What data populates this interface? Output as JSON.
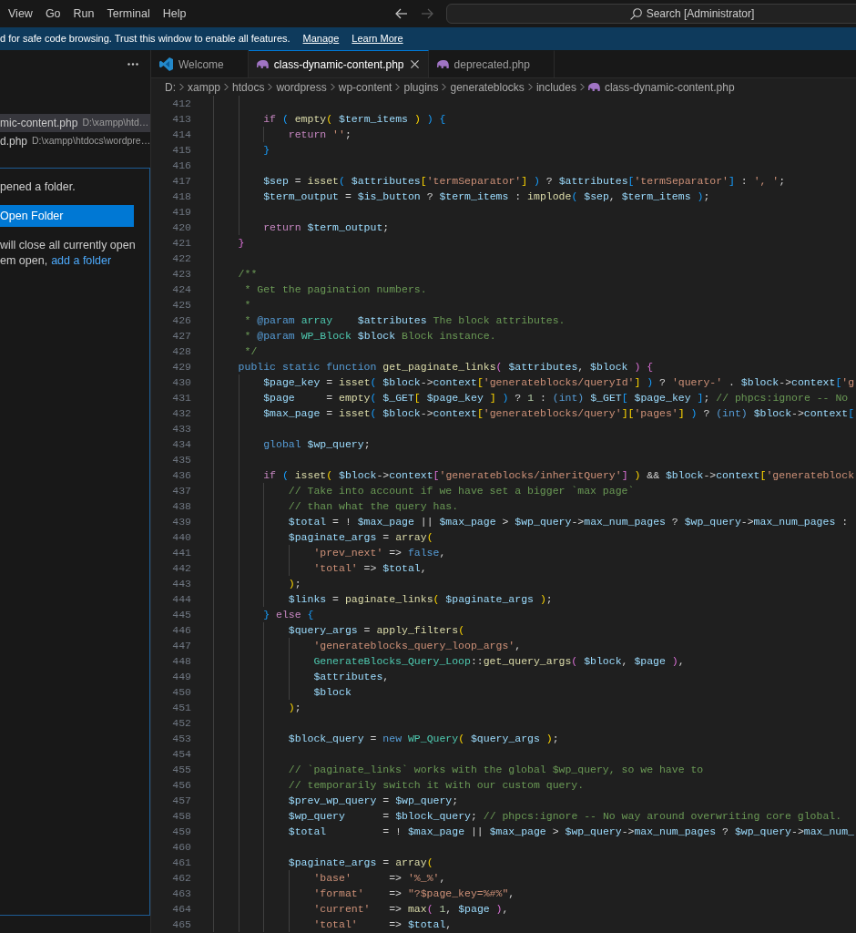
{
  "title_bar": {
    "menu": [
      "View",
      "Go",
      "Run",
      "Terminal",
      "Help"
    ],
    "nav": [
      {
        "kind": "back",
        "disabled": false
      },
      {
        "kind": "forward",
        "disabled": true
      }
    ],
    "search": {
      "label": "Search [Administrator]"
    }
  },
  "banner": {
    "message": "d for safe code browsing. Trust this window to enable all features.",
    "links": [
      "Manage",
      "Learn More"
    ]
  },
  "sidebar": {
    "open_editors": [
      {
        "name": "mic-content.php",
        "path": "D:\\xampp\\htd…",
        "selected": true
      },
      {
        "name": "d.php",
        "path": "D:\\xampp\\htdocs\\wordpre…",
        "selected": false
      }
    ],
    "no_folder": {
      "message": "pened a folder.",
      "button": "Open Folder",
      "note": "will close all currently open",
      "note_end": "em open,",
      "link": "add a folder"
    }
  },
  "tabs": [
    {
      "label": "Welcome",
      "kind": "welcome",
      "selected": false
    },
    {
      "label": "class-dynamic-content.php",
      "kind": "php",
      "selected": true
    },
    {
      "label": "deprecated.php",
      "kind": "php",
      "selected": false
    }
  ],
  "breadcrumb": [
    {
      "label": "D:",
      "kind": "folder"
    },
    {
      "label": "xampp",
      "kind": "folder"
    },
    {
      "label": "htdocs",
      "kind": "folder"
    },
    {
      "label": "wordpress",
      "kind": "folder"
    },
    {
      "label": "wp-content",
      "kind": "folder"
    },
    {
      "label": "plugins",
      "kind": "folder"
    },
    {
      "label": "generateblocks",
      "kind": "folder"
    },
    {
      "label": "includes",
      "kind": "folder"
    },
    {
      "label": "class-dynamic-content.php",
      "kind": "php"
    }
  ],
  "editor": {
    "lines": [
      {
        "number": "412"
      },
      {
        "number": "413",
        "code": [
          {
            "kind": "ctl",
            "text": "        if"
          },
          {
            "kind": "pun",
            "text": " ( "
          },
          {
            "kind": "fn",
            "text": "empty"
          },
          {
            "kind": "pun",
            "text": "( "
          },
          {
            "kind": "var",
            "text": "$term_items"
          },
          {
            "kind": "pun",
            "text": " ) ) {"
          }
        ]
      },
      {
        "number": "414",
        "code": [
          {
            "kind": "ctl",
            "text": "            return "
          },
          {
            "kind": "str",
            "text": "''"
          },
          {
            "kind": "pun",
            "text": ";"
          }
        ]
      },
      {
        "number": "415",
        "code": [
          {
            "kind": "pun",
            "text": "        }"
          }
        ]
      },
      {
        "number": "416"
      },
      {
        "number": "417",
        "code": [
          {
            "kind": "var",
            "text": "        $sep"
          },
          {
            "kind": "pun",
            "text": " = "
          },
          {
            "kind": "fn",
            "text": "isset"
          },
          {
            "kind": "pun",
            "text": "( "
          },
          {
            "kind": "var",
            "text": "$attributes"
          },
          {
            "kind": "pun",
            "text": "["
          },
          {
            "kind": "str",
            "text": "'termSeparator'"
          },
          {
            "kind": "pun",
            "text": "] ) ? "
          },
          {
            "kind": "var",
            "text": "$attributes"
          },
          {
            "kind": "pun",
            "text": "["
          },
          {
            "kind": "str",
            "text": "'termSeparator'"
          },
          {
            "kind": "pun",
            "text": "] : "
          },
          {
            "kind": "str",
            "text": "', '"
          },
          {
            "kind": "pun",
            "text": ";"
          }
        ]
      },
      {
        "number": "418",
        "code": [
          {
            "kind": "var",
            "text": "        $term_output"
          },
          {
            "kind": "pun",
            "text": " = "
          },
          {
            "kind": "var",
            "text": "$is_button"
          },
          {
            "kind": "pun",
            "text": " ? "
          },
          {
            "kind": "var",
            "text": "$term_items"
          },
          {
            "kind": "pun",
            "text": " : "
          },
          {
            "kind": "fn",
            "text": "implode"
          },
          {
            "kind": "pun",
            "text": "( "
          },
          {
            "kind": "var",
            "text": "$sep"
          },
          {
            "kind": "pun",
            "text": ", "
          },
          {
            "kind": "var",
            "text": "$term_items"
          },
          {
            "kind": "pun",
            "text": " );"
          }
        ]
      },
      {
        "number": "419"
      },
      {
        "number": "420",
        "code": [
          {
            "kind": "ctl",
            "text": "        return "
          },
          {
            "kind": "var",
            "text": "$term_output"
          },
          {
            "kind": "pun",
            "text": ";"
          }
        ]
      },
      {
        "number": "421",
        "code": [
          {
            "kind": "pun",
            "text": "    }"
          }
        ]
      },
      {
        "number": "422"
      },
      {
        "number": "423",
        "code": [
          {
            "kind": "com",
            "text": "    /**"
          }
        ]
      },
      {
        "number": "424",
        "code": [
          {
            "kind": "com",
            "text": "     * Get the pagination numbers."
          }
        ]
      },
      {
        "number": "425",
        "code": [
          {
            "kind": "com",
            "text": "     *"
          }
        ]
      },
      {
        "number": "426",
        "code": [
          {
            "kind": "com",
            "text": "     * "
          },
          {
            "kind": "tag",
            "text": "@param "
          },
          {
            "kind": "type",
            "text": "array    "
          },
          {
            "kind": "var",
            "text": "$attributes"
          },
          {
            "kind": "com",
            "text": " The block attributes."
          }
        ]
      },
      {
        "number": "427",
        "code": [
          {
            "kind": "com",
            "text": "     * "
          },
          {
            "kind": "tag",
            "text": "@param "
          },
          {
            "kind": "type",
            "text": "WP_Block "
          },
          {
            "kind": "var",
            "text": "$block"
          },
          {
            "kind": "com",
            "text": " Block instance."
          }
        ]
      },
      {
        "number": "428",
        "code": [
          {
            "kind": "com",
            "text": "     */"
          }
        ]
      },
      {
        "number": "429",
        "code": [
          {
            "kind": "key",
            "text": "    public static function "
          },
          {
            "kind": "fn",
            "text": "get_paginate_links"
          },
          {
            "kind": "pun",
            "text": "( "
          },
          {
            "kind": "var",
            "text": "$attributes"
          },
          {
            "kind": "pun",
            "text": ", "
          },
          {
            "kind": "var",
            "text": "$block"
          },
          {
            "kind": "pun",
            "text": " ) {"
          }
        ]
      },
      {
        "number": "430",
        "code": [
          {
            "kind": "var",
            "text": "        $page_key"
          },
          {
            "kind": "pun",
            "text": " = "
          },
          {
            "kind": "fn",
            "text": "isset"
          },
          {
            "kind": "pun",
            "text": "( "
          },
          {
            "kind": "var",
            "text": "$block"
          },
          {
            "kind": "pun",
            "text": "->"
          },
          {
            "kind": "var",
            "text": "context"
          },
          {
            "kind": "pun",
            "text": "["
          },
          {
            "kind": "str",
            "text": "'generateblocks/queryId'"
          },
          {
            "kind": "pun",
            "text": "] ) ? "
          },
          {
            "kind": "str",
            "text": "'query-'"
          },
          {
            "kind": "pun",
            "text": " . "
          },
          {
            "kind": "var",
            "text": "$block"
          },
          {
            "kind": "pun",
            "text": "->"
          },
          {
            "kind": "var",
            "text": "context"
          },
          {
            "kind": "pun",
            "text": "["
          },
          {
            "kind": "str",
            "text": "'g"
          }
        ]
      },
      {
        "number": "431",
        "code": [
          {
            "kind": "var",
            "text": "        $page"
          },
          {
            "kind": "pun",
            "text": "     = "
          },
          {
            "kind": "fn",
            "text": "empty"
          },
          {
            "kind": "pun",
            "text": "( "
          },
          {
            "kind": "var",
            "text": "$_GET"
          },
          {
            "kind": "pun",
            "text": "[ "
          },
          {
            "kind": "var",
            "text": "$page_key"
          },
          {
            "kind": "pun",
            "text": " ] ) ? "
          },
          {
            "kind": "num",
            "text": "1"
          },
          {
            "kind": "pun",
            "text": " : "
          },
          {
            "kind": "key",
            "text": "(int) "
          },
          {
            "kind": "var",
            "text": "$_GET"
          },
          {
            "kind": "pun",
            "text": "[ "
          },
          {
            "kind": "var",
            "text": "$page_key"
          },
          {
            "kind": "pun",
            "text": " ]; "
          },
          {
            "kind": "com",
            "text": "// phpcs:ignore -- No"
          }
        ]
      },
      {
        "number": "432",
        "code": [
          {
            "kind": "var",
            "text": "        $max_page"
          },
          {
            "kind": "pun",
            "text": " = "
          },
          {
            "kind": "fn",
            "text": "isset"
          },
          {
            "kind": "pun",
            "text": "( "
          },
          {
            "kind": "var",
            "text": "$block"
          },
          {
            "kind": "pun",
            "text": "->"
          },
          {
            "kind": "var",
            "text": "context"
          },
          {
            "kind": "pun",
            "text": "["
          },
          {
            "kind": "str",
            "text": "'generateblocks/query'"
          },
          {
            "kind": "pun",
            "text": "]["
          },
          {
            "kind": "str",
            "text": "'pages'"
          },
          {
            "kind": "pun",
            "text": "] ) ? "
          },
          {
            "kind": "key",
            "text": "(int) "
          },
          {
            "kind": "var",
            "text": "$block"
          },
          {
            "kind": "pun",
            "text": "->"
          },
          {
            "kind": "var",
            "text": "context"
          },
          {
            "kind": "pun",
            "text": "["
          }
        ]
      },
      {
        "number": "433"
      },
      {
        "number": "434",
        "code": [
          {
            "kind": "key",
            "text": "        global "
          },
          {
            "kind": "var",
            "text": "$wp_query"
          },
          {
            "kind": "pun",
            "text": ";"
          }
        ]
      },
      {
        "number": "435"
      },
      {
        "number": "436",
        "code": [
          {
            "kind": "ctl",
            "text": "        if"
          },
          {
            "kind": "pun",
            "text": " ( "
          },
          {
            "kind": "fn",
            "text": "isset"
          },
          {
            "kind": "pun",
            "text": "( "
          },
          {
            "kind": "var",
            "text": "$block"
          },
          {
            "kind": "pun",
            "text": "->"
          },
          {
            "kind": "var",
            "text": "context"
          },
          {
            "kind": "pun",
            "text": "["
          },
          {
            "kind": "str",
            "text": "'generateblocks/inheritQuery'"
          },
          {
            "kind": "pun",
            "text": "] ) && "
          },
          {
            "kind": "var",
            "text": "$block"
          },
          {
            "kind": "pun",
            "text": "->"
          },
          {
            "kind": "var",
            "text": "context"
          },
          {
            "kind": "pun",
            "text": "["
          },
          {
            "kind": "str",
            "text": "'generateblock"
          }
        ]
      },
      {
        "number": "437",
        "code": [
          {
            "kind": "com",
            "text": "            // Take into account if we have set a bigger `max page`"
          }
        ]
      },
      {
        "number": "438",
        "code": [
          {
            "kind": "com",
            "text": "            // than what the query has."
          }
        ]
      },
      {
        "number": "439",
        "code": [
          {
            "kind": "var",
            "text": "            $total"
          },
          {
            "kind": "pun",
            "text": " = ! "
          },
          {
            "kind": "var",
            "text": "$max_page"
          },
          {
            "kind": "pun",
            "text": " || "
          },
          {
            "kind": "var",
            "text": "$max_page"
          },
          {
            "kind": "pun",
            "text": " > "
          },
          {
            "kind": "var",
            "text": "$wp_query"
          },
          {
            "kind": "pun",
            "text": "->"
          },
          {
            "kind": "var",
            "text": "max_num_pages"
          },
          {
            "kind": "pun",
            "text": " ? "
          },
          {
            "kind": "var",
            "text": "$wp_query"
          },
          {
            "kind": "pun",
            "text": "->"
          },
          {
            "kind": "var",
            "text": "max_num_pages"
          },
          {
            "kind": "pun",
            "text": " :"
          }
        ]
      },
      {
        "number": "440",
        "code": [
          {
            "kind": "var",
            "text": "            $paginate_args"
          },
          {
            "kind": "pun",
            "text": " = "
          },
          {
            "kind": "fn",
            "text": "array"
          },
          {
            "kind": "pun",
            "text": "("
          }
        ]
      },
      {
        "number": "441",
        "code": [
          {
            "kind": "str",
            "text": "                'prev_next'"
          },
          {
            "kind": "pun",
            "text": " => "
          },
          {
            "kind": "key",
            "text": "false"
          },
          {
            "kind": "pun",
            "text": ","
          }
        ]
      },
      {
        "number": "442",
        "code": [
          {
            "kind": "str",
            "text": "                'total'"
          },
          {
            "kind": "pun",
            "text": " => "
          },
          {
            "kind": "var",
            "text": "$total"
          },
          {
            "kind": "pun",
            "text": ","
          }
        ]
      },
      {
        "number": "443",
        "code": [
          {
            "kind": "pun",
            "text": "            );"
          }
        ]
      },
      {
        "number": "444",
        "code": [
          {
            "kind": "var",
            "text": "            $links"
          },
          {
            "kind": "pun",
            "text": " = "
          },
          {
            "kind": "fn",
            "text": "paginate_links"
          },
          {
            "kind": "pun",
            "text": "( "
          },
          {
            "kind": "var",
            "text": "$paginate_args"
          },
          {
            "kind": "pun",
            "text": " );"
          }
        ]
      },
      {
        "number": "445",
        "code": [
          {
            "kind": "pun",
            "text": "        } "
          },
          {
            "kind": "ctl",
            "text": "else"
          },
          {
            "kind": "pun",
            "text": " {"
          }
        ]
      },
      {
        "number": "446",
        "code": [
          {
            "kind": "var",
            "text": "            $query_args"
          },
          {
            "kind": "pun",
            "text": " = "
          },
          {
            "kind": "fn",
            "text": "apply_filters"
          },
          {
            "kind": "pun",
            "text": "("
          }
        ]
      },
      {
        "number": "447",
        "code": [
          {
            "kind": "str",
            "text": "                'generateblocks_query_loop_args'"
          },
          {
            "kind": "pun",
            "text": ","
          }
        ]
      },
      {
        "number": "448",
        "code": [
          {
            "kind": "type",
            "text": "                GenerateBlocks_Query_Loop"
          },
          {
            "kind": "pun",
            "text": "::"
          },
          {
            "kind": "fn",
            "text": "get_query_args"
          },
          {
            "kind": "pun",
            "text": "( "
          },
          {
            "kind": "var",
            "text": "$block"
          },
          {
            "kind": "pun",
            "text": ", "
          },
          {
            "kind": "var",
            "text": "$page"
          },
          {
            "kind": "pun",
            "text": " ),"
          }
        ]
      },
      {
        "number": "449",
        "code": [
          {
            "kind": "var",
            "text": "                $attributes"
          },
          {
            "kind": "pun",
            "text": ","
          }
        ]
      },
      {
        "number": "450",
        "code": [
          {
            "kind": "var",
            "text": "                $block"
          }
        ]
      },
      {
        "number": "451",
        "code": [
          {
            "kind": "pun",
            "text": "            );"
          }
        ]
      },
      {
        "number": "452"
      },
      {
        "number": "453",
        "code": [
          {
            "kind": "var",
            "text": "            $block_query"
          },
          {
            "kind": "pun",
            "text": " = "
          },
          {
            "kind": "key",
            "text": "new "
          },
          {
            "kind": "type",
            "text": "WP_Query"
          },
          {
            "kind": "pun",
            "text": "( "
          },
          {
            "kind": "var",
            "text": "$query_args"
          },
          {
            "kind": "pun",
            "text": " );"
          }
        ]
      },
      {
        "number": "454"
      },
      {
        "number": "455",
        "code": [
          {
            "kind": "com",
            "text": "            // `paginate_links` works with the global $wp_query, so we have to"
          }
        ]
      },
      {
        "number": "456",
        "code": [
          {
            "kind": "com",
            "text": "            // temporarily switch it with our custom query."
          }
        ]
      },
      {
        "number": "457",
        "code": [
          {
            "kind": "var",
            "text": "            $prev_wp_query"
          },
          {
            "kind": "pun",
            "text": " = "
          },
          {
            "kind": "var",
            "text": "$wp_query"
          },
          {
            "kind": "pun",
            "text": ";"
          }
        ]
      },
      {
        "number": "458",
        "code": [
          {
            "kind": "var",
            "text": "            $wp_query"
          },
          {
            "kind": "pun",
            "text": "      = "
          },
          {
            "kind": "var",
            "text": "$block_query"
          },
          {
            "kind": "pun",
            "text": "; "
          },
          {
            "kind": "com",
            "text": "// phpcs:ignore -- No way around overwriting core global."
          }
        ]
      },
      {
        "number": "459",
        "code": [
          {
            "kind": "var",
            "text": "            $total"
          },
          {
            "kind": "pun",
            "text": "         = ! "
          },
          {
            "kind": "var",
            "text": "$max_page"
          },
          {
            "kind": "pun",
            "text": " || "
          },
          {
            "kind": "var",
            "text": "$max_page"
          },
          {
            "kind": "pun",
            "text": " > "
          },
          {
            "kind": "var",
            "text": "$wp_query"
          },
          {
            "kind": "pun",
            "text": "->"
          },
          {
            "kind": "var",
            "text": "max_num_pages"
          },
          {
            "kind": "pun",
            "text": " ? "
          },
          {
            "kind": "var",
            "text": "$wp_query"
          },
          {
            "kind": "pun",
            "text": "->"
          },
          {
            "kind": "var",
            "text": "max_num_"
          }
        ]
      },
      {
        "number": "460"
      },
      {
        "number": "461",
        "code": [
          {
            "kind": "var",
            "text": "            $paginate_args"
          },
          {
            "kind": "pun",
            "text": " = "
          },
          {
            "kind": "fn",
            "text": "array"
          },
          {
            "kind": "pun",
            "text": "("
          }
        ]
      },
      {
        "number": "462",
        "code": [
          {
            "kind": "str",
            "text": "                'base'"
          },
          {
            "kind": "pun",
            "text": "      => "
          },
          {
            "kind": "str",
            "text": "'%_%'"
          },
          {
            "kind": "pun",
            "text": ","
          }
        ]
      },
      {
        "number": "463",
        "code": [
          {
            "kind": "str",
            "text": "                'format'"
          },
          {
            "kind": "pun",
            "text": "    => "
          },
          {
            "kind": "str",
            "text": "\"?$page_key=%#%\""
          },
          {
            "kind": "pun",
            "text": ","
          }
        ]
      },
      {
        "number": "464",
        "code": [
          {
            "kind": "str",
            "text": "                'current'"
          },
          {
            "kind": "pun",
            "text": "   => "
          },
          {
            "kind": "fn",
            "text": "max"
          },
          {
            "kind": "pun",
            "text": "( "
          },
          {
            "kind": "num",
            "text": "1"
          },
          {
            "kind": "pun",
            "text": ", "
          },
          {
            "kind": "var",
            "text": "$page"
          },
          {
            "kind": "pun",
            "text": " ),"
          }
        ]
      },
      {
        "number": "465",
        "code": [
          {
            "kind": "str",
            "text": "                'total'"
          },
          {
            "kind": "pun",
            "text": "     => "
          },
          {
            "kind": "var",
            "text": "$total"
          },
          {
            "kind": "pun",
            "text": ","
          }
        ]
      }
    ]
  }
}
